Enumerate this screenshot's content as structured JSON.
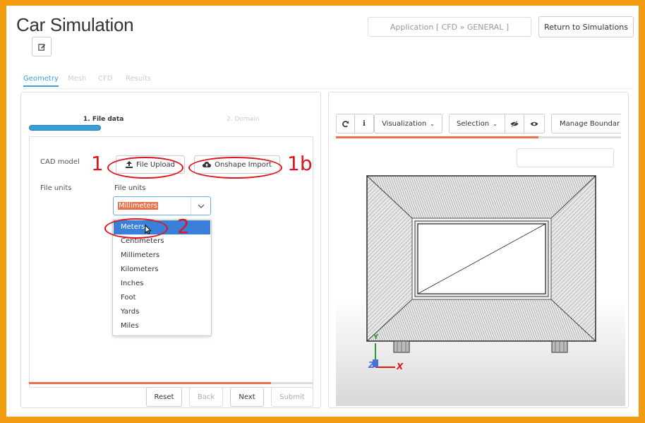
{
  "header": {
    "title": "Car Simulation",
    "application_label": "Application [ CFD » GENERAL ]",
    "return_button": "Return to Simulations"
  },
  "tabs": [
    {
      "label": "Geometry",
      "active": true
    },
    {
      "label": "Mesh",
      "active": false
    },
    {
      "label": "CFD",
      "active": false
    },
    {
      "label": "Results",
      "active": false
    }
  ],
  "steps": {
    "step1": "1. File data",
    "step2": "2. Domain"
  },
  "form": {
    "cad_label": "CAD model",
    "file_upload": "File Upload",
    "onshape_import": "Onshape Import",
    "units_label": "File units",
    "units_field_label": "File units",
    "units_selected": "Millimeters",
    "unit_options": [
      "Meters",
      "Centimeters",
      "Millimeters",
      "Kilometers",
      "Inches",
      "Foot",
      "Yards",
      "Miles"
    ]
  },
  "annotations": {
    "a1": "1",
    "a1b": "1b",
    "a2": "2"
  },
  "footer": {
    "reset": "Reset",
    "back": "Back",
    "next": "Next",
    "submit": "Submit"
  },
  "viewer": {
    "visualization": "Visualization",
    "selection": "Selection",
    "manage_boundaries": "Manage Boundar",
    "axis_x": "X",
    "axis_y": "Y",
    "axis_z": "Z"
  },
  "colors": {
    "frame": "#f39c12",
    "accent_blue": "#3a9fd8",
    "progress_orange": "#e8734a",
    "annotation_red": "#e0141e"
  }
}
